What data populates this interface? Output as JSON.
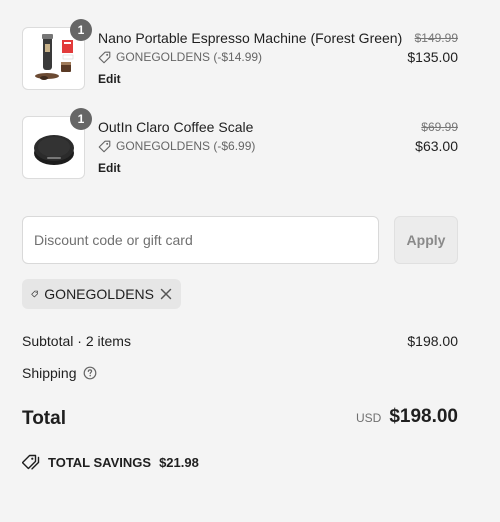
{
  "cart": {
    "items": [
      {
        "name": "Nano Portable Espresso Machine (Forest Green)",
        "quantity": "1",
        "discount": "GONEGOLDENS (-$14.99)",
        "edit": "Edit",
        "original_price": "$149.99",
        "price": "$135.00"
      },
      {
        "name": "OutIn Claro Coffee Scale",
        "quantity": "1",
        "discount": "GONEGOLDENS (-$6.99)",
        "edit": "Edit",
        "original_price": "$69.99",
        "price": "$63.00"
      }
    ]
  },
  "discount": {
    "placeholder": "Discount code or gift card",
    "value": "",
    "apply_label": "Apply",
    "applied_code": "GONEGOLDENS"
  },
  "summary": {
    "subtotal_label": "Subtotal · 2 items",
    "subtotal_value": "$198.00",
    "shipping_label": "Shipping",
    "total_label": "Total",
    "currency": "USD",
    "total_value": "$198.00",
    "savings_label": "TOTAL SAVINGS",
    "savings_value": "$21.98"
  },
  "colors": {
    "background": "#f4f4f4",
    "badge": "#666666",
    "text": "#1f1f1f",
    "muted": "#707070"
  }
}
